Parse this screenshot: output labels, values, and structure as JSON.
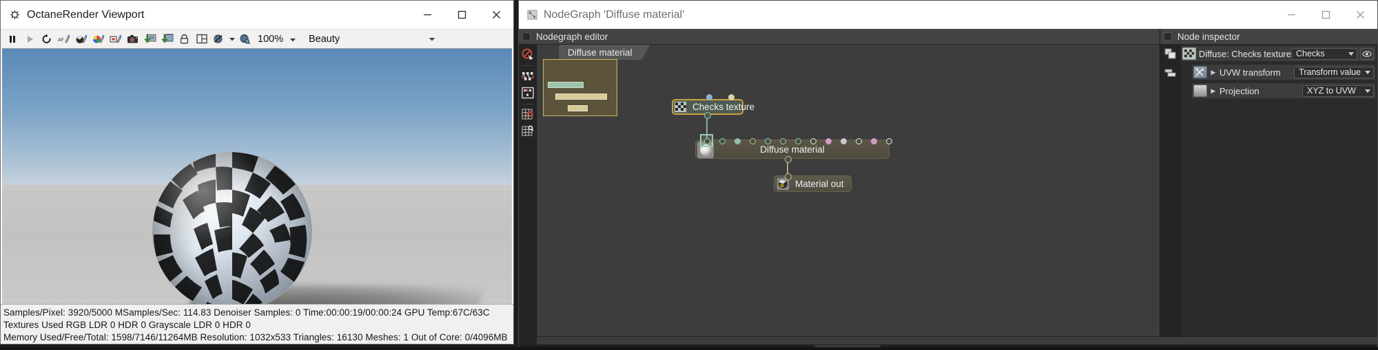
{
  "viewport_window": {
    "title": "OctaneRender Viewport",
    "title_icon": "octane-logo-icon",
    "window_controls": {
      "minimize": "—",
      "maximize": "□",
      "close": "✕"
    },
    "toolbar": {
      "buttons": [
        {
          "name": "pause-render-button",
          "icon": "pause-icon"
        },
        {
          "name": "start-render-button",
          "icon": "play-icon"
        },
        {
          "name": "restart-render-button",
          "icon": "refresh-icon"
        },
        {
          "name": "pick-focus-button",
          "icon": "focus-picker-icon"
        },
        {
          "name": "pick-material-button",
          "icon": "material-picker-icon"
        },
        {
          "name": "pick-white-balance-button",
          "icon": "color-picker-icon"
        },
        {
          "name": "pick-render-region-button",
          "icon": "region-picker-icon"
        },
        {
          "name": "save-render-button",
          "icon": "camera-icon"
        },
        {
          "name": "save-image-button",
          "icon": "save-image-icon"
        },
        {
          "name": "save-layers-button",
          "icon": "save-layers-icon"
        },
        {
          "name": "lock-resolution-button",
          "icon": "lock-icon"
        },
        {
          "name": "grid-layout-button",
          "icon": "grid-icon"
        },
        {
          "name": "clay-mode-button",
          "icon": "clay-mode-icon"
        },
        {
          "name": "zoom-mode-button",
          "icon": "zoom-mode-icon"
        }
      ],
      "zoom_value": "100%",
      "pass_value": "Beauty"
    },
    "status": {
      "line1": "Samples/Pixel: 3920/5000  MSamples/Sec: 114.83  Denoiser Samples: 0  Time:00:00:19/00:00:24  GPU Temp:67C/63C",
      "line2": "Textures Used RGB LDR 0  HDR 0  Grayscale LDR 0  HDR 0",
      "line3": "Memory Used/Free/Total: 1598/7146/11264MB  Resolution: 1032x533  Triangles: 16130  Meshes: 1 Out of Core: 0/4096MB"
    }
  },
  "nodegraph_window": {
    "title": "NodeGraph 'Diffuse material'",
    "title_icon": "nodegraph-icon",
    "window_controls": {
      "minimize": "—",
      "maximize": "□",
      "close": "✕"
    },
    "editor_panel": {
      "header": "Nodegraph editor",
      "tab": "Diffuse material",
      "side_tools": [
        {
          "name": "delete-node-tool",
          "icon": "delete-node-icon"
        },
        {
          "name": "group-nodes-tool",
          "icon": "group-nodes-icon"
        },
        {
          "name": "ungroup-nodes-tool",
          "icon": "ungroup-nodes-icon"
        },
        {
          "name": "snap-to-grid-tool",
          "icon": "magnet-grid-icon"
        },
        {
          "name": "show-grid-tool",
          "icon": "grid-view-icon"
        }
      ],
      "nodes": [
        {
          "name": "checks-texture-node",
          "label": "Checks texture",
          "icon": "checks-texture-icon",
          "selected": true
        },
        {
          "name": "diffuse-material-node",
          "label": "Diffuse material",
          "icon": "diffuse-material-icon",
          "selected": false
        },
        {
          "name": "material-out-node",
          "label": "Material out",
          "icon": "material-out-icon",
          "selected": false
        }
      ]
    },
    "inspector_panel": {
      "header": "Node inspector",
      "rail": [
        {
          "name": "copy-settings-button",
          "icon": "copy-icon"
        },
        {
          "name": "paste-settings-button",
          "icon": "paste-icon"
        }
      ],
      "rows": [
        {
          "name": "diffuse-checks-texture-row",
          "icon": "checks-texture-icon",
          "label": "Diffuse: Checks texture",
          "value": "Checks",
          "has_eye": true,
          "indent": false,
          "has_arrow": false
        },
        {
          "name": "uvw-transform-row",
          "icon": "uvw-transform-icon",
          "label": "UVW transform",
          "value": "Transform value",
          "has_eye": false,
          "indent": true,
          "has_arrow": true
        },
        {
          "name": "projection-row",
          "icon": "projection-icon",
          "label": "Projection",
          "value": "XYZ to UVW",
          "has_eye": false,
          "indent": true,
          "has_arrow": true
        }
      ]
    }
  },
  "colors": {
    "pin_green": "#8fc0a8",
    "pin_olive": "#c9c08a",
    "pin_white": "#e8e8e8",
    "pin_pink": "#d0a0c4",
    "pin_grey": "#c8c8c8",
    "pin_blue": "#8eb3d4",
    "pin_tan": "#ded3a7",
    "node_selected_border": "#c8a23c",
    "wire_green": "#9ec9b4",
    "wire_olive": "#cbc08c",
    "minimap_bg": "#5c543a",
    "accent_titlebar": "#ffffff"
  }
}
